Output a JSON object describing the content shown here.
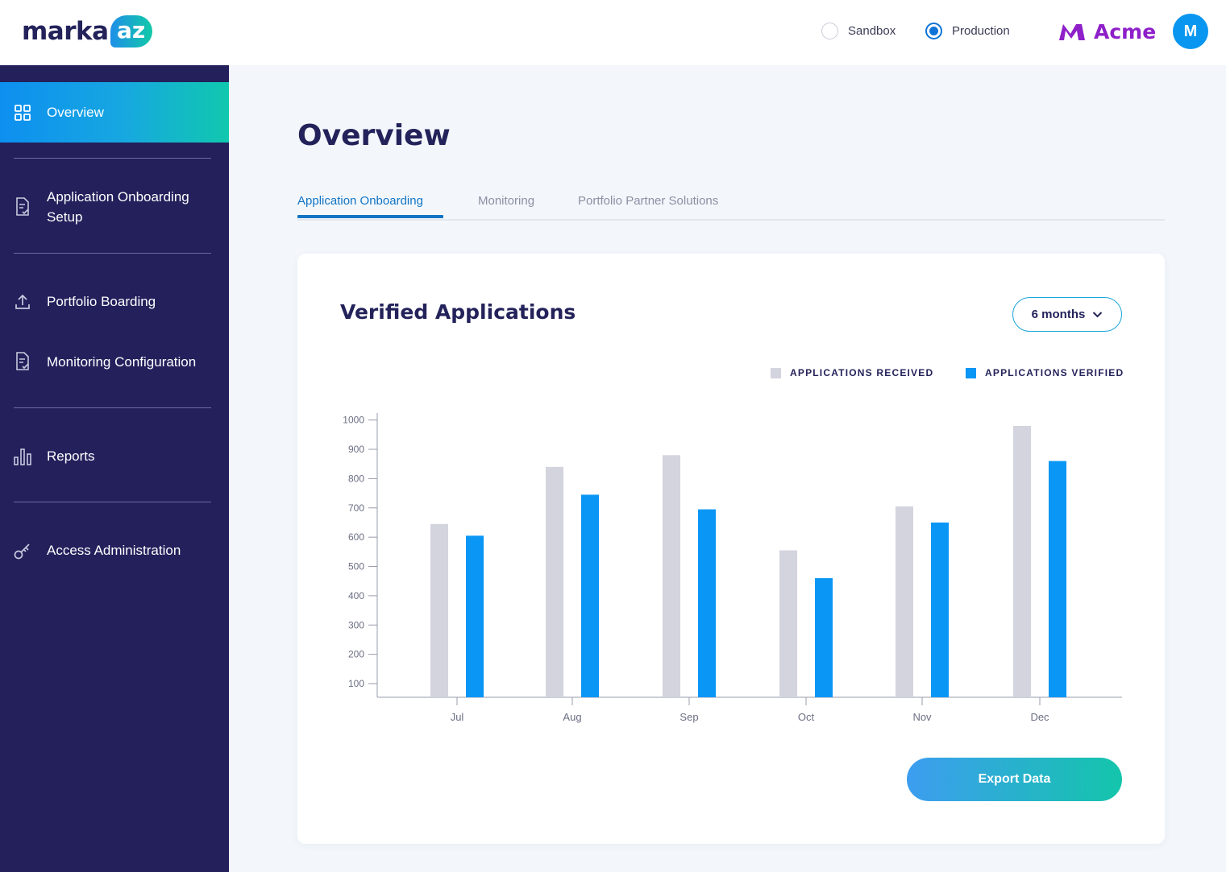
{
  "header": {
    "logo": {
      "text": "marka",
      "accent": "az"
    },
    "env_options": [
      {
        "label": "Sandbox",
        "selected": false
      },
      {
        "label": "Production",
        "selected": true
      }
    ],
    "brand": {
      "name": "Acme",
      "color": "#8e1fc9"
    },
    "avatar_initial": "M"
  },
  "sidebar": {
    "items": [
      {
        "label": "Overview",
        "icon": "grid-icon",
        "active": true
      },
      {
        "label": "Application Onboarding Setup",
        "icon": "document-check-icon",
        "active": false
      },
      {
        "label": "Portfolio Boarding",
        "icon": "upload-icon",
        "active": false
      },
      {
        "label": "Monitoring Configuration",
        "icon": "document-check-icon",
        "active": false
      },
      {
        "label": "Reports",
        "icon": "bar-chart-icon",
        "active": false
      },
      {
        "label": "Access Administration",
        "icon": "key-icon",
        "active": false
      }
    ]
  },
  "main": {
    "title": "Overview",
    "tabs": [
      {
        "label": "Application Onboarding",
        "active": true
      },
      {
        "label": "Monitoring",
        "active": false
      },
      {
        "label": "Portfolio Partner Solutions",
        "active": false
      }
    ],
    "card": {
      "title": "Verified Applications",
      "range": "6 months",
      "export_label": "Export Data"
    }
  },
  "colors": {
    "accent": "#0f73d8",
    "sidebar_bg": "#23205c",
    "received": "#d3d4de",
    "verified": "#0996f5"
  },
  "chart_data": {
    "type": "bar",
    "categories": [
      "Jul",
      "Aug",
      "Sep",
      "Oct",
      "Nov",
      "Dec"
    ],
    "series": [
      {
        "name": "APPLICATIONS RECEIVED",
        "values": [
          645,
          840,
          880,
          555,
          705,
          980
        ]
      },
      {
        "name": "APPLICATIONS VERIFIED",
        "values": [
          605,
          745,
          695,
          460,
          650,
          860
        ]
      }
    ],
    "yticks": [
      100,
      200,
      300,
      400,
      500,
      600,
      700,
      800,
      900,
      1000
    ],
    "ylim": [
      40,
      1000
    ],
    "legend": "top-right",
    "grid": false
  }
}
